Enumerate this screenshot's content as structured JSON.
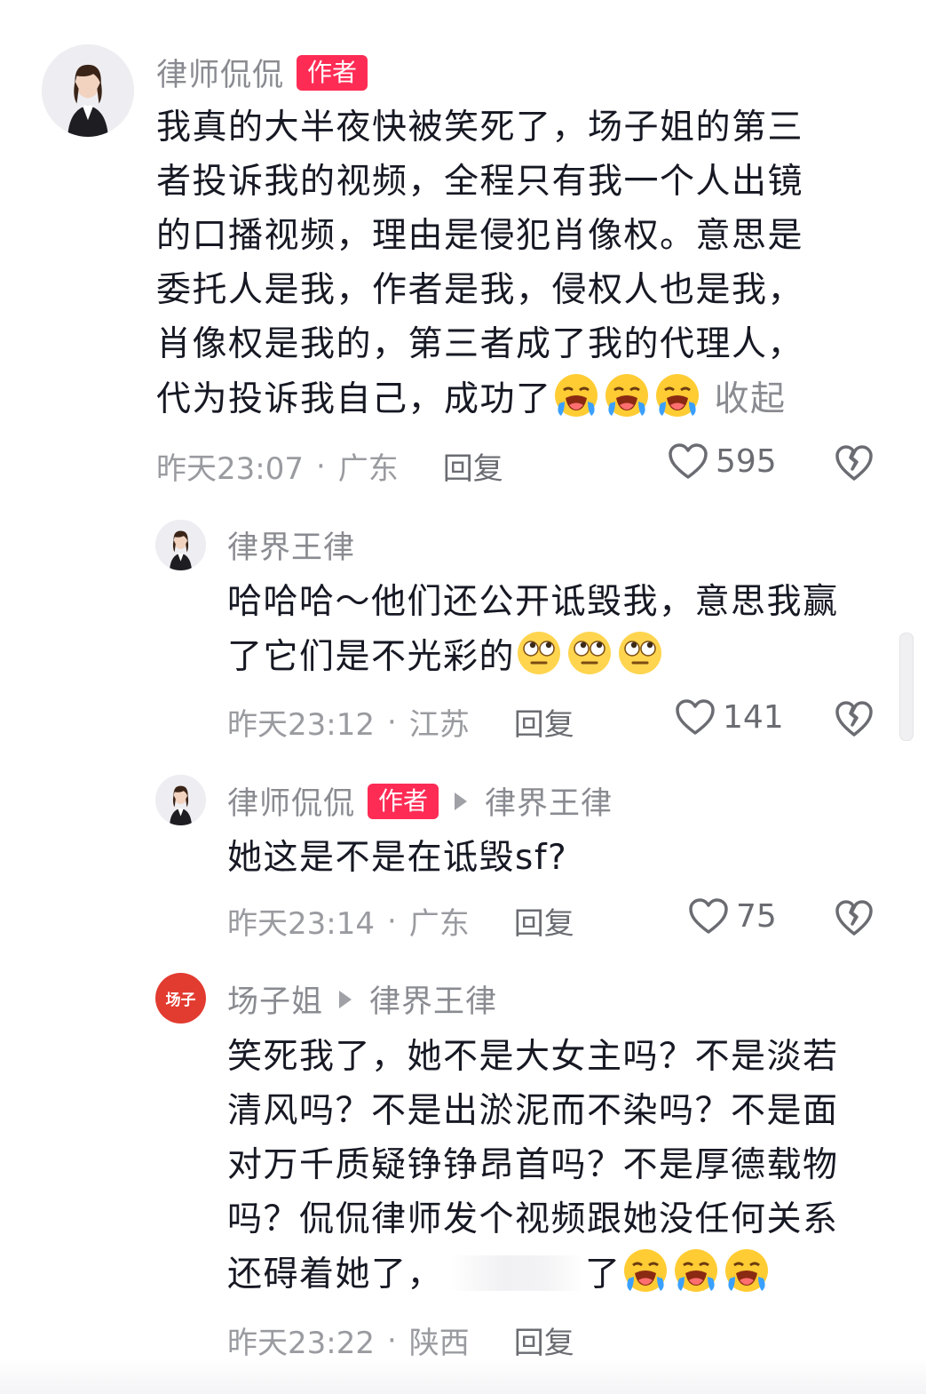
{
  "colors": {
    "accent": "#fe2c55",
    "name_gray": "#8a8b91",
    "text": "#161823"
  },
  "comments": [
    {
      "name": "律师侃侃",
      "badge": "作者",
      "lines": [
        "我真的大半夜快被笑死了，场子姐的第三",
        "者投诉我的视频，全程只有我一个人出镜",
        "的口播视频，理由是侵犯肖像权。意思是",
        "委托人是我，作者是我，侵权人也是我，",
        "肖像权是我的，第三者成了我的代理人，",
        "代为投诉我自己，成功了"
      ],
      "emoji": "loudly-crying-face",
      "emoji_count": 3,
      "collapse_label": "收起",
      "time": "昨天23:07",
      "location": "广东",
      "reply_label": "回复",
      "likes": "595"
    },
    {
      "name": "律界王律",
      "lines": [
        "哈哈哈～他们还公开诋毁我，意思我赢",
        "了它们是不光彩的"
      ],
      "emoji": "rolling-eyes-face",
      "emoji_count": 3,
      "time": "昨天23:12",
      "location": "江苏",
      "reply_label": "回复",
      "likes": "141"
    },
    {
      "name": "律师侃侃",
      "badge": "作者",
      "reply_to": "律界王律",
      "lines": [
        "她这是不是在诋毁sf?"
      ],
      "time": "昨天23:14",
      "location": "广东",
      "reply_label": "回复",
      "likes": "75"
    },
    {
      "name": "场子姐",
      "avatar_text": "场子",
      "reply_to": "律界王律",
      "lines": [
        "笑死我了，她不是大女主吗？不是淡若",
        "清风吗？不是出淤泥而不染吗？不是面",
        "对万千质疑铮铮昂首吗？不是厚德载物",
        "吗？侃侃律师发个视频跟她没任何关系",
        "还碍着她了，"
      ],
      "last_line_tail": "了",
      "emoji": "loudly-crying-face",
      "emoji_count": 3,
      "time": "昨天23:22",
      "location": "陕西",
      "reply_label": "回复"
    }
  ]
}
